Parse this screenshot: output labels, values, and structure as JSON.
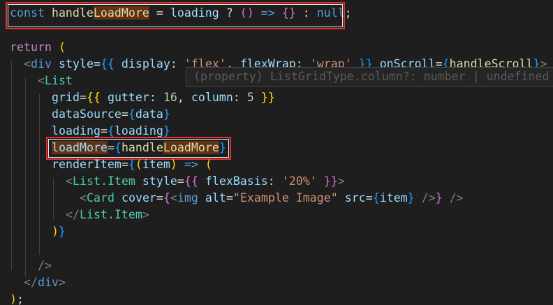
{
  "editor": {
    "line1": {
      "kw_const": "const",
      "name_prefix": "handle",
      "name_highlight": "LoadMore",
      "eq": "=",
      "loading": "loading",
      "q": "?",
      "paren": "()",
      "arrow": "=>",
      "braces": "{}",
      "colon": ":",
      "null_kw": "null",
      "semi": ";"
    },
    "line_return": {
      "kw": "return",
      "paren": "("
    },
    "line_div": {
      "open": "<",
      "tag": "div",
      "attr_style": "style",
      "eq": "=",
      "open_braces": "{{",
      "display_key": "display",
      "colon": ":",
      "flex_str": "'flex'",
      "comma": ",",
      "flexwrap_key": "flexWrap",
      "wrap_str": "'wrap'",
      "close_braces": "}}",
      "onscroll": "onScroll",
      "open_brace": "{",
      "handler": "handleScroll",
      "close_brace": "}",
      "close": ">"
    },
    "line_list": {
      "open": "<",
      "tag": "List"
    },
    "hover_hint": "(property) ListGridType.column?: number | undefined",
    "line_grid": {
      "attr": "grid",
      "eq": "=",
      "open": "{{",
      "gutter_key": "gutter",
      "colon": ":",
      "gutter_val": "16",
      "comma": ",",
      "column_key": "column",
      "column_val": "5",
      "close": "}}"
    },
    "line_datasource": {
      "attr": "dataSource",
      "eq": "=",
      "open": "{",
      "val": "data",
      "close": "}"
    },
    "line_loading": {
      "attr": "loading",
      "eq": "=",
      "open": "{",
      "val": "loading",
      "close": "}"
    },
    "line_loadmore": {
      "attr_highlight": "loadMore",
      "eq": "=",
      "open": "{",
      "val_prefix": "handle",
      "val_highlight": "LoadMore",
      "close": "}"
    },
    "line_renderitem": {
      "attr": "renderItem",
      "eq": "=",
      "open": "{",
      "paren_open": "(",
      "param": "item",
      "paren_close": ")",
      "arrow": "=>",
      "paren": "("
    },
    "line_listitem": {
      "open": "<",
      "tag": "List.Item",
      "attr": "style",
      "eq": "=",
      "open_braces": "{{",
      "key": "flexBasis",
      "colon": ":",
      "val": "'20%'",
      "close_braces": "}}",
      "close": ">"
    },
    "line_card": {
      "open": "<",
      "tag": "Card",
      "attr": "cover",
      "eq": "=",
      "open_brace": "{",
      "img_open": "<",
      "img_tag": "img",
      "alt_attr": "alt",
      "eq2": "=",
      "alt_val": "\"Example Image\"",
      "src_attr": "src",
      "eq3": "=",
      "src_open": "{",
      "src_val": "item",
      "src_close": "}",
      "img_close": "/>",
      "close_brace": "}",
      "self_close": "/>"
    },
    "line_listitem_close": {
      "open": "</",
      "tag": "List.Item",
      "close": ">"
    },
    "line_paren_close": {
      "paren": ")",
      "brace": "}"
    },
    "line_list_close": {
      "close": "/>"
    },
    "line_div_close": {
      "open": "</",
      "tag": "div",
      "close": ">"
    },
    "line_end": {
      "paren": ")",
      "semi": ";"
    }
  },
  "colors": {
    "background": "#1e1e1e",
    "highlight_box": "#e03030",
    "word_highlight": "#613214",
    "keyword": "#569cd6",
    "control": "#c586c0",
    "variable": "#9cdcfe",
    "function": "#dcdcaa",
    "component": "#4ec9b0",
    "string": "#ce9178",
    "number": "#b5cea8"
  }
}
